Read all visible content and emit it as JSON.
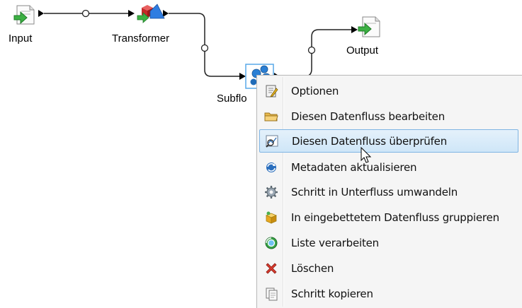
{
  "nodes": {
    "input": {
      "label": "Input"
    },
    "transformer": {
      "label": "Transformer"
    },
    "subflow": {
      "label": "Subflo"
    },
    "output": {
      "label": "Output"
    }
  },
  "context_menu": {
    "items": [
      {
        "label": "Optionen",
        "icon": "options-icon"
      },
      {
        "label": "Diesen Datenfluss bearbeiten",
        "icon": "folder-icon"
      },
      {
        "label": "Diesen Datenfluss überprüfen",
        "icon": "inspect-icon",
        "highlighted": true
      },
      {
        "label": "Metadaten aktualisieren",
        "icon": "refresh-metadata-icon"
      },
      {
        "label": "Schritt in Unterfluss umwandeln",
        "icon": "gear-icon"
      },
      {
        "label": "In eingebettetem Datenfluss gruppieren",
        "icon": "group-box-icon"
      },
      {
        "label": "Liste verarbeiten",
        "icon": "process-list-icon"
      },
      {
        "label": "Löschen",
        "icon": "delete-icon"
      },
      {
        "label": "Schritt kopieren",
        "icon": "copy-icon"
      }
    ]
  },
  "colors": {
    "menu_bg": "#f5f5f5",
    "highlight_border": "#7fb4e3",
    "highlight_bg": "#d9ebf9",
    "connector": "#222222"
  }
}
